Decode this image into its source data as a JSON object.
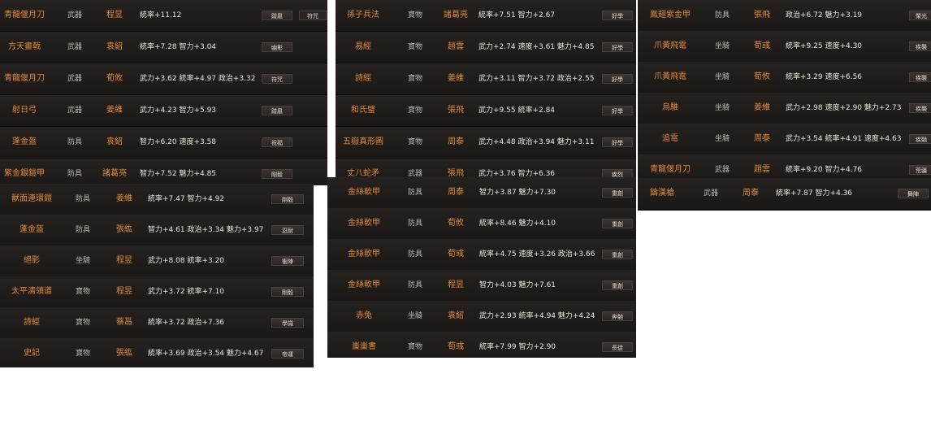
{
  "panels": [
    {
      "rows": [
        {
          "name": "青龍偃月刀",
          "type": "武器",
          "owner": "程昱",
          "stats": "統率+11.12",
          "skill": "跋扈",
          "skill2": "符咒"
        },
        {
          "name": "方天畫戟",
          "type": "武器",
          "owner": "袁紹",
          "stats": "統率+7.28  智力+3.04",
          "skill": "幽影"
        },
        {
          "name": "青龍偃月刀",
          "type": "武器",
          "owner": "荀攸",
          "stats": "武力+3.62  統率+4.97  政治+3.32",
          "skill": "符咒"
        },
        {
          "name": "射日弓",
          "type": "武器",
          "owner": "姜維",
          "stats": "武力+4.23  智力+5.93",
          "skill": "跋扈"
        },
        {
          "name": "蓬金盔",
          "type": "防具",
          "owner": "袁紹",
          "stats": "智力+6.20  速度+3.58",
          "skill": "祝福"
        },
        {
          "name": "紫金銀鎧甲",
          "type": "防具",
          "owner": "諸葛亮",
          "stats": "智力+7.52  魅力+4.85",
          "skill": "剛毅"
        }
      ]
    },
    {
      "rows": [
        {
          "name": "獸面連環鎧",
          "type": "防具",
          "owner": "姜維",
          "stats": "統率+7.47  智力+4.92",
          "skill": "剛毅"
        },
        {
          "name": "蓬金盔",
          "type": "防具",
          "owner": "張紘",
          "stats": "智力+4.61  政治+3.34  魅力+3.97",
          "skill": "忍耐"
        },
        {
          "name": "絕影",
          "type": "坐騎",
          "owner": "程昱",
          "stats": "武力+8.08  統率+3.20",
          "skill": "衝陣"
        },
        {
          "name": "太平清領道",
          "type": "寶物",
          "owner": "程昱",
          "stats": "武力+3.72  統率+7.10",
          "skill": "剛毅"
        },
        {
          "name": "詩經",
          "type": "寶物",
          "owner": "蔡邕",
          "stats": "統率+3.72  政治+7.36",
          "skill": "學識"
        },
        {
          "name": "史記",
          "type": "寶物",
          "owner": "張紘",
          "stats": "統率+3.69  政治+3.54  魅力+4.67",
          "skill": "帝運"
        }
      ]
    },
    {
      "rows": [
        {
          "name": "孫子兵法",
          "type": "寶物",
          "owner": "諸葛亮",
          "stats": "統率+7.51  智力+2.67",
          "skill": "好學"
        },
        {
          "name": "易經",
          "type": "寶物",
          "owner": "趙雲",
          "stats": "武力+2.74  速度+3.61  魅力+4.85",
          "skill": "好學"
        },
        {
          "name": "詩經",
          "type": "寶物",
          "owner": "姜維",
          "stats": "武力+3.11  智力+3.72  政治+2.55",
          "skill": "好學"
        },
        {
          "name": "和氏璧",
          "type": "寶物",
          "owner": "張飛",
          "stats": "武力+9.55  統率+2.84",
          "skill": "好學"
        },
        {
          "name": "五嶽真形圖",
          "type": "寶物",
          "owner": "周泰",
          "stats": "武力+4.48  政治+3.94  魅力+3.11",
          "skill": "好學"
        },
        {
          "name": "丈八蛇矛",
          "type": "武器",
          "owner": "張飛",
          "stats": "武力+3.76  智力+6.36",
          "skill": "疾烈"
        }
      ]
    },
    {
      "rows": [
        {
          "name": "金絲軟甲",
          "type": "防具",
          "owner": "周泰",
          "stats": "智力+3.87  魅力+7.30",
          "skill": "重創"
        },
        {
          "name": "金絲軟甲",
          "type": "防具",
          "owner": "荀攸",
          "stats": "統率+8.46  魅力+4.10",
          "skill": "重創"
        },
        {
          "name": "金絲軟甲",
          "type": "防具",
          "owner": "荀彧",
          "stats": "統率+4.75  速度+3.26  政治+3.66",
          "skill": "重創"
        },
        {
          "name": "金絲軟甲",
          "type": "防具",
          "owner": "程昱",
          "stats": "智力+4.03  魅力+7.61",
          "skill": "重創"
        },
        {
          "name": "赤兔",
          "type": "坐騎",
          "owner": "袁紹",
          "stats": "武力+2.93  統率+4.94  魅力+4.24",
          "skill": "奔馳"
        },
        {
          "name": "蚩蚩書",
          "type": "寶物",
          "owner": "荀彧",
          "stats": "統率+7.99  智力+2.90",
          "skill": "長徒"
        }
      ]
    },
    {
      "rows": [
        {
          "name": "鳳翅紫金甲",
          "type": "防具",
          "owner": "張飛",
          "stats": "政治+6.72  魅力+3.19",
          "skill": "榮光"
        },
        {
          "name": "爪黃飛電",
          "type": "坐騎",
          "owner": "荀彧",
          "stats": "統率+9.25  速度+4.30",
          "skill": "疾襲"
        },
        {
          "name": "爪黃飛電",
          "type": "坐騎",
          "owner": "荀攸",
          "stats": "統率+3.29  速度+6.56",
          "skill": "疾襲"
        },
        {
          "name": "烏騅",
          "type": "坐騎",
          "owner": "姜維",
          "stats": "武力+2.98  速度+2.90  魅力+2.73",
          "skill": "疾襲"
        },
        {
          "name": "追電",
          "type": "坐騎",
          "owner": "周泰",
          "stats": "武力+3.54  統率+4.91  速度+4.63",
          "skill": "疾馳"
        },
        {
          "name": "青龍偃月刀",
          "type": "武器",
          "owner": "趙雲",
          "stats": "統率+9.20  智力+4.76",
          "skill": "荒疆"
        }
      ]
    },
    {
      "rows": [
        {
          "name": "鑄漢槍",
          "type": "武器",
          "owner": "周泰",
          "stats": "統率+7.87  智力+4.36",
          "skill": "舞陣"
        }
      ]
    }
  ]
}
